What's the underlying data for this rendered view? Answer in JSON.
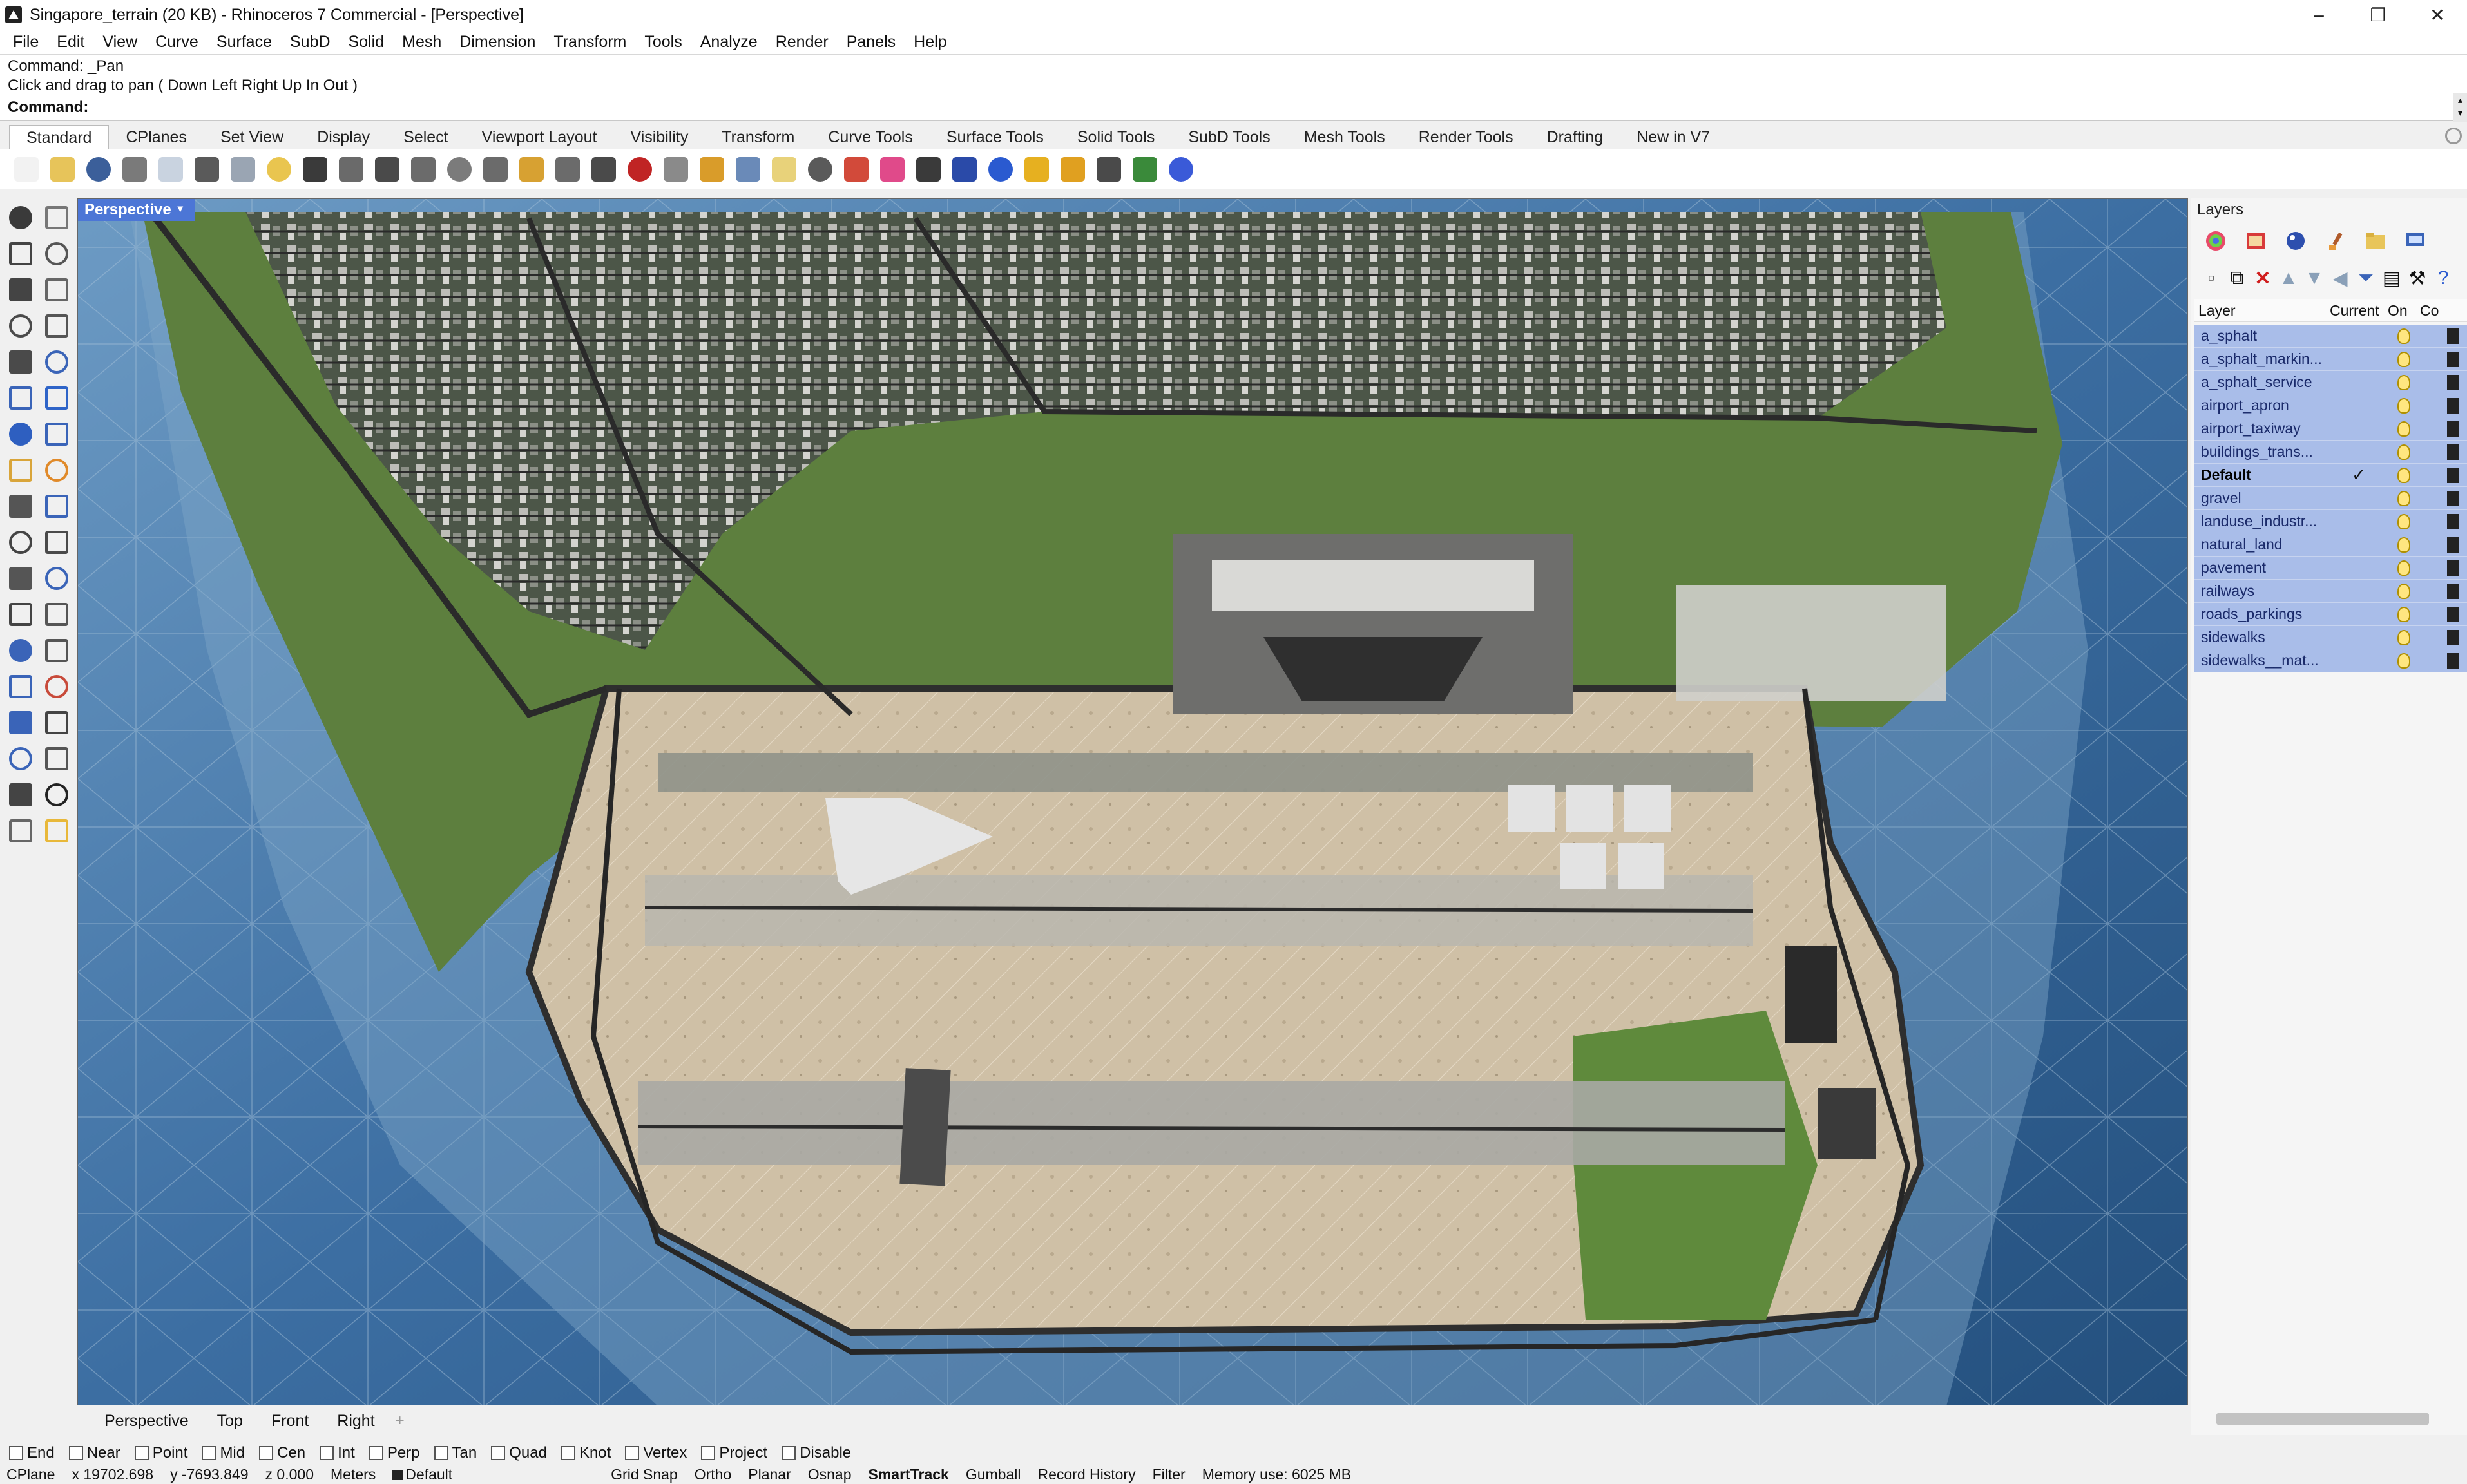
{
  "window": {
    "title": "Singapore_terrain (20 KB) - Rhinoceros 7 Commercial - [Perspective]",
    "minimize": "–",
    "restore": "❐",
    "close": "✕"
  },
  "menu": [
    "File",
    "Edit",
    "View",
    "Curve",
    "Surface",
    "SubD",
    "Solid",
    "Mesh",
    "Dimension",
    "Transform",
    "Tools",
    "Analyze",
    "Render",
    "Panels",
    "Help"
  ],
  "command": {
    "history_line1": "Command: _Pan",
    "history_line2": "Click and drag to pan ( Down  Left  Right  Up  In  Out )",
    "prompt": "Command:",
    "input_value": ""
  },
  "toolbar_tabs": [
    "Standard",
    "CPlanes",
    "Set View",
    "Display",
    "Select",
    "Viewport Layout",
    "Visibility",
    "Transform",
    "Curve Tools",
    "Surface Tools",
    "Solid Tools",
    "SubD Tools",
    "Mesh Tools",
    "Render Tools",
    "Drafting",
    "New in V7"
  ],
  "toolbar_icons": [
    "new-icon",
    "open-icon",
    "save-icon",
    "print-icon",
    "import-icon",
    "cut-icon",
    "copy-icon",
    "paste-icon",
    "undo-icon",
    "pan-icon",
    "rotate-view-icon",
    "zoom-icon",
    "zoom-window-icon",
    "zoom-extents-icon",
    "zoom-selected-icon",
    "zoom-all-icon",
    "four-viewports-icon",
    "car-icon",
    "block-icon",
    "gumball-icon",
    "cplane-icon",
    "light-icon",
    "lock-icon",
    "layer-icon",
    "color-wheel-icon",
    "sphere-icon",
    "render-sphere-icon",
    "render-icon",
    "cursor-icon",
    "options-icon",
    "grid-icon",
    "globe-icon",
    "help-icon"
  ],
  "toolbar_colors": [
    "#f2f2f2",
    "#e7c45a",
    "#3b5f9a",
    "#7a7a7a",
    "#c9d3e0",
    "#5a5a5a",
    "#9aa5b3",
    "#e9c54f",
    "#3a3a3a",
    "#6a6a6a",
    "#4a4a4a",
    "#6b6b6b",
    "#7b7b7b",
    "#6b6b6b",
    "#d7a132",
    "#6b6b6b",
    "#4a4a4a",
    "#c02424",
    "#8a8a8a",
    "#d99c2a",
    "#6a8ab8",
    "#e8d27a",
    "#5a5a5a",
    "#d24a3a",
    "#e04a8a",
    "#3a3a3a",
    "#2a4aa8",
    "#2a5ad0",
    "#e6b020",
    "#e0a020",
    "#4a4a4a",
    "#3a8a3a",
    "#3a5ad8"
  ],
  "left_tools": [
    "select-arrow-icon",
    "point-icon",
    "polyline-icon",
    "curve-icon",
    "circle-icon",
    "ellipse-icon",
    "arc-icon",
    "rectangle-icon",
    "polygon-icon",
    "freeform-icon",
    "surface-icon",
    "loft-icon",
    "box-icon",
    "sphere-solid-icon",
    "cylinder-icon",
    "extrude-icon",
    "explode-icon",
    "boolean-icon",
    "move-icon",
    "scale-icon",
    "boolean-union-icon",
    "offset-icon",
    "fillet-icon",
    "trim-icon",
    "text-icon",
    "dimension-icon",
    "array-icon",
    "mirror-icon",
    "align-icon",
    "orient-icon",
    "grid-array-icon",
    "transform-icon",
    "analyze-icon",
    "check-icon",
    "edit-icon",
    "render-icon"
  ],
  "viewport": {
    "label": "Perspective",
    "tabs": [
      "Perspective",
      "Top",
      "Front",
      "Right"
    ],
    "add_tab": "+"
  },
  "layers": {
    "title": "Layers",
    "columns": {
      "layer": "Layer",
      "current": "Current",
      "on": "On",
      "color": "Co"
    },
    "rows": [
      {
        "name": "a_sphalt",
        "current": "",
        "bold": false
      },
      {
        "name": "a_sphalt_markin...",
        "current": "",
        "bold": false
      },
      {
        "name": "a_sphalt_service",
        "current": "",
        "bold": false
      },
      {
        "name": "airport_apron",
        "current": "",
        "bold": false
      },
      {
        "name": "airport_taxiway",
        "current": "",
        "bold": false
      },
      {
        "name": "buildings_trans...",
        "current": "",
        "bold": false
      },
      {
        "name": "Default",
        "current": "✓",
        "bold": true
      },
      {
        "name": "gravel",
        "current": "",
        "bold": false
      },
      {
        "name": "landuse_industr...",
        "current": "",
        "bold": false
      },
      {
        "name": "natural_land",
        "current": "",
        "bold": false
      },
      {
        "name": "pavement",
        "current": "",
        "bold": false
      },
      {
        "name": "railways",
        "current": "",
        "bold": false
      },
      {
        "name": "roads_parkings",
        "current": "",
        "bold": false
      },
      {
        "name": "sidewalks",
        "current": "",
        "bold": false
      },
      {
        "name": "sidewalks__mat...",
        "current": "",
        "bold": false
      }
    ]
  },
  "osnaps": [
    {
      "label": "End",
      "checked": false
    },
    {
      "label": "Near",
      "checked": false
    },
    {
      "label": "Point",
      "checked": false
    },
    {
      "label": "Mid",
      "checked": false
    },
    {
      "label": "Cen",
      "checked": false
    },
    {
      "label": "Int",
      "checked": false
    },
    {
      "label": "Perp",
      "checked": false
    },
    {
      "label": "Tan",
      "checked": false
    },
    {
      "label": "Quad",
      "checked": false
    },
    {
      "label": "Knot",
      "checked": false
    },
    {
      "label": "Vertex",
      "checked": false
    },
    {
      "label": "Project",
      "checked": false
    },
    {
      "label": "Disable",
      "checked": false
    }
  ],
  "status": {
    "cplane": "CPlane",
    "x": "x 19702.698",
    "y": "y -7693.849",
    "z": "z 0.000",
    "units": "Meters",
    "layer": "Default",
    "grid_snap": "Grid Snap",
    "ortho": "Ortho",
    "planar": "Planar",
    "osnap": "Osnap",
    "smarttrack": "SmartTrack",
    "gumball": "Gumball",
    "record_history": "Record History",
    "filter": "Filter",
    "memory": "Memory use: 6025 MB"
  }
}
